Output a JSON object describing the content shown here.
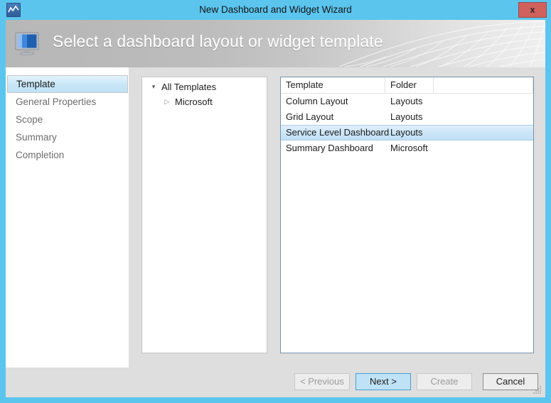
{
  "window": {
    "title": "New Dashboard and Widget Wizard",
    "icon": "chart-wave-icon",
    "close_label": "x"
  },
  "banner": {
    "heading": "Select a dashboard layout or widget template",
    "icon": "monitor-icon"
  },
  "sidebar": {
    "items": [
      {
        "label": "Template",
        "selected": true
      },
      {
        "label": "General Properties",
        "selected": false
      },
      {
        "label": "Scope",
        "selected": false
      },
      {
        "label": "Summary",
        "selected": false
      },
      {
        "label": "Completion",
        "selected": false
      }
    ]
  },
  "tree": {
    "root": {
      "label": "All Templates",
      "glyph": "expanded-triangle-icon",
      "expanded": true
    },
    "children": [
      {
        "label": "Microsoft",
        "glyph": "collapsed-triangle-icon",
        "expanded": false
      }
    ]
  },
  "list": {
    "columns": [
      "Template",
      "Folder",
      ""
    ],
    "rows": [
      {
        "template": "Column Layout",
        "folder": "Layouts",
        "selected": false
      },
      {
        "template": "Grid Layout",
        "folder": "Layouts",
        "selected": false
      },
      {
        "template": "Service Level Dashboard",
        "folder": "Layouts",
        "selected": true
      },
      {
        "template": "Summary Dashboard",
        "folder": "Microsoft",
        "selected": false
      }
    ]
  },
  "footer": {
    "previous": "< Previous",
    "next": "Next >",
    "create": "Create",
    "cancel": "Cancel"
  },
  "colors": {
    "window_frame": "#5bc5ee",
    "close_button": "#d1615d",
    "selection_blue": "#c2e0f6",
    "primary_button": "#bfe2f7"
  }
}
